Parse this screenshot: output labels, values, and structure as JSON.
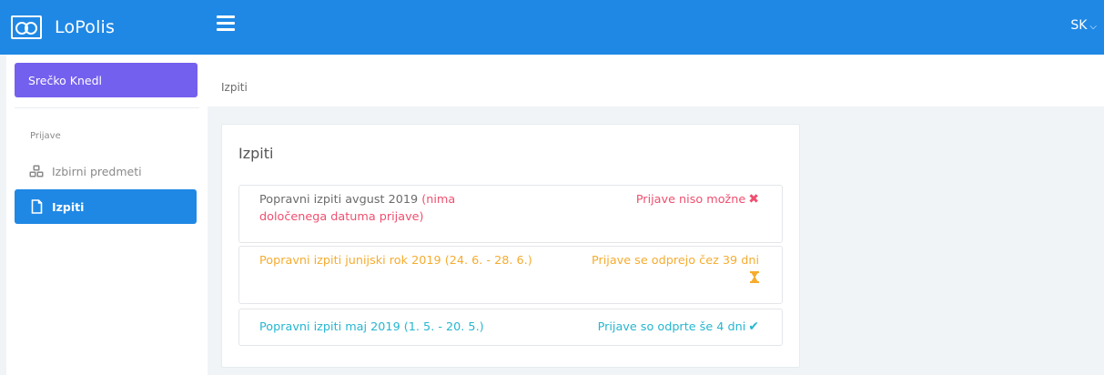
{
  "app": {
    "name": "LoPolis",
    "language": "SK"
  },
  "sidebar": {
    "user_name": "Srečko Knedl",
    "section_label": "Prijave",
    "items": [
      {
        "label": "Izbirni predmeti",
        "icon": "cubes-icon",
        "active": false
      },
      {
        "label": "Izpiti",
        "icon": "file-icon",
        "active": true
      }
    ]
  },
  "breadcrumb": "Izpiti",
  "card": {
    "title": "Izpiti",
    "exams": [
      {
        "title": "Popravni izpiti avgust 2019",
        "detail": "(nima določenega datuma prijave)",
        "status": "Prijave niso možne",
        "status_icon": "close-icon",
        "color": "#ef4f6f"
      },
      {
        "title": "Popravni izpiti junijski rok 2019 (24. 6. - 28. 6.)",
        "status": "Prijave se odprejo čez 39 dni",
        "status_icon": "hourglass-icon",
        "color": "#f5ac2f"
      },
      {
        "title": "Popravni izpiti maj 2019 (1. 5. - 20. 5.)",
        "status": "Prijave so odprte še 4 dni",
        "status_icon": "check-icon",
        "color": "#26b6d0"
      }
    ]
  },
  "colors": {
    "primary": "#1f88e5",
    "user_button": "#7460ee",
    "background": "#f0f4f7"
  }
}
